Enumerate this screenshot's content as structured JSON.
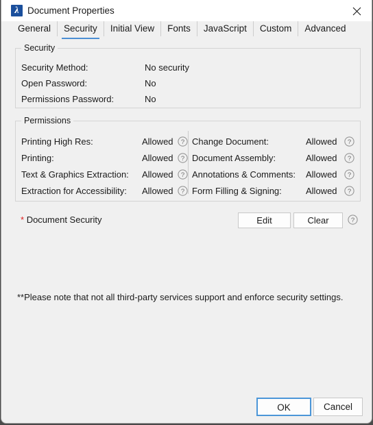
{
  "window": {
    "title": "Document Properties",
    "icon": "pdf-app-icon",
    "close_label": "✕"
  },
  "tabs": [
    {
      "label": "General",
      "active": false
    },
    {
      "label": "Security",
      "active": true
    },
    {
      "label": "Initial View",
      "active": false
    },
    {
      "label": "Fonts",
      "active": false
    },
    {
      "label": "JavaScript",
      "active": false
    },
    {
      "label": "Custom",
      "active": false
    },
    {
      "label": "Advanced",
      "active": false
    }
  ],
  "security_group": {
    "legend": "Security",
    "rows": [
      {
        "label": "Security Method:",
        "value": "No security"
      },
      {
        "label": "Open Password:",
        "value": "No"
      },
      {
        "label": "Permissions Password:",
        "value": "No"
      }
    ]
  },
  "permissions_group": {
    "legend": "Permissions",
    "left_rows": [
      {
        "label": "Printing High Res:",
        "value": "Allowed",
        "help": "help-icon"
      },
      {
        "label": "Printing:",
        "value": "Allowed",
        "help": "help-icon"
      },
      {
        "label": "Text & Graphics Extraction:",
        "value": "Allowed",
        "help": "help-icon"
      },
      {
        "label": "Extraction for Accessibility:",
        "value": "Allowed",
        "help": "help-icon"
      }
    ],
    "right_rows": [
      {
        "label": "Change Document:",
        "value": "Allowed",
        "help": "help-icon"
      },
      {
        "label": "Document Assembly:",
        "value": "Allowed",
        "help": "help-icon"
      },
      {
        "label": "Annotations & Comments:",
        "value": "Allowed",
        "help": "help-icon"
      },
      {
        "label": "Form Filling & Signing:",
        "value": "Allowed",
        "help": "help-icon"
      }
    ]
  },
  "document_security": {
    "asterisk": "*",
    "label": "Document Security",
    "edit_label": "Edit",
    "clear_label": "Clear"
  },
  "note": "**Please note that not all third-party services support and enforce security settings.",
  "footer": {
    "ok_label": "OK",
    "cancel_label": "Cancel"
  },
  "colors": {
    "accent": "#4b8fd4",
    "focus_border": "#4b96d8",
    "asterisk": "#e02020",
    "dialog_bg": "#f0f0f0",
    "titlebar_bg": "#ffffff",
    "app_icon_bg": "#1b4f9c"
  }
}
